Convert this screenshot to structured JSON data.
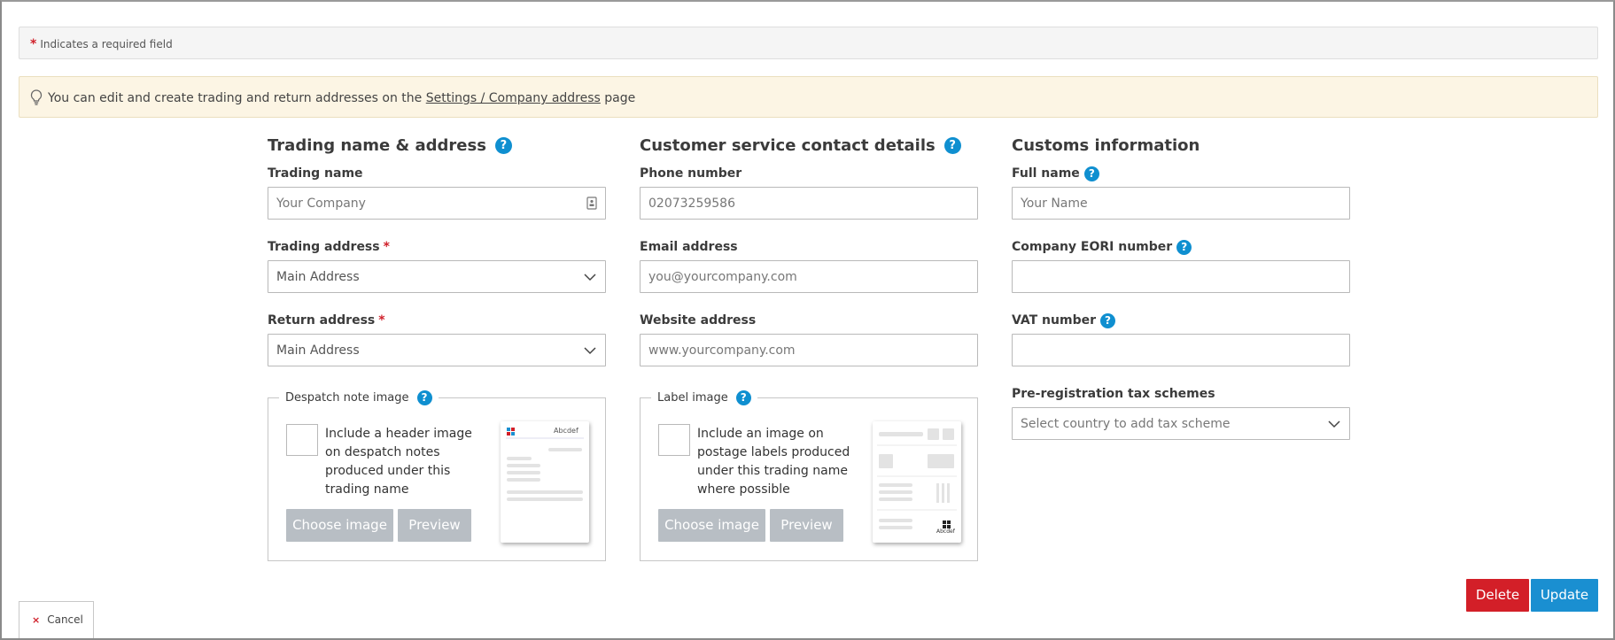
{
  "required_notice": {
    "star": "*",
    "text": "Indicates a required field"
  },
  "tip": {
    "text_before": "You can edit and create trading and return addresses on the",
    "link": "Settings / Company address",
    "text_after": "page"
  },
  "trading": {
    "title": "Trading name & address",
    "help": "?",
    "name_label": "Trading name",
    "name_value": "Your Company",
    "address_label": "Trading address",
    "address_value": "Main Address",
    "return_label": "Return address",
    "return_value": "Main Address",
    "required_star": "*",
    "despatch": {
      "legend": "Despatch note image",
      "checkbox_text": "Include a header image on despatch notes produced under this trading name",
      "choose": "Choose image",
      "preview": "Preview",
      "thumb_label": "Abcdef"
    }
  },
  "customer_service": {
    "title": "Customer service contact details",
    "help": "?",
    "phone_label": "Phone number",
    "phone_value": "02073259586",
    "email_label": "Email address",
    "email_placeholder": "you@yourcompany.com",
    "website_label": "Website address",
    "website_placeholder": "www.yourcompany.com",
    "label_image": {
      "legend": "Label image",
      "checkbox_text": "Include an image on postage labels produced under this trading name where possible",
      "choose": "Choose image",
      "preview": "Preview",
      "thumb_label": "Abcdef"
    }
  },
  "customs": {
    "title": "Customs information",
    "fullname_label": "Full name",
    "fullname_placeholder": "Your Name",
    "eori_label": "Company EORI number",
    "vat_label": "VAT number",
    "tax_label": "Pre-registration tax schemes",
    "tax_placeholder": "Select country to add tax scheme",
    "help": "?"
  },
  "actions": {
    "delete": "Delete",
    "update": "Update",
    "cancel": "Cancel",
    "cancel_icon": "×"
  },
  "colors": {
    "accent": "#1a8fd1",
    "danger": "#d31f28",
    "required": "#d0202a",
    "tip_bg": "#fcf5e4"
  },
  "icons": [
    "lightbulb-icon",
    "help-icon",
    "chevron-down-icon",
    "contact-card-icon",
    "close-icon"
  ]
}
